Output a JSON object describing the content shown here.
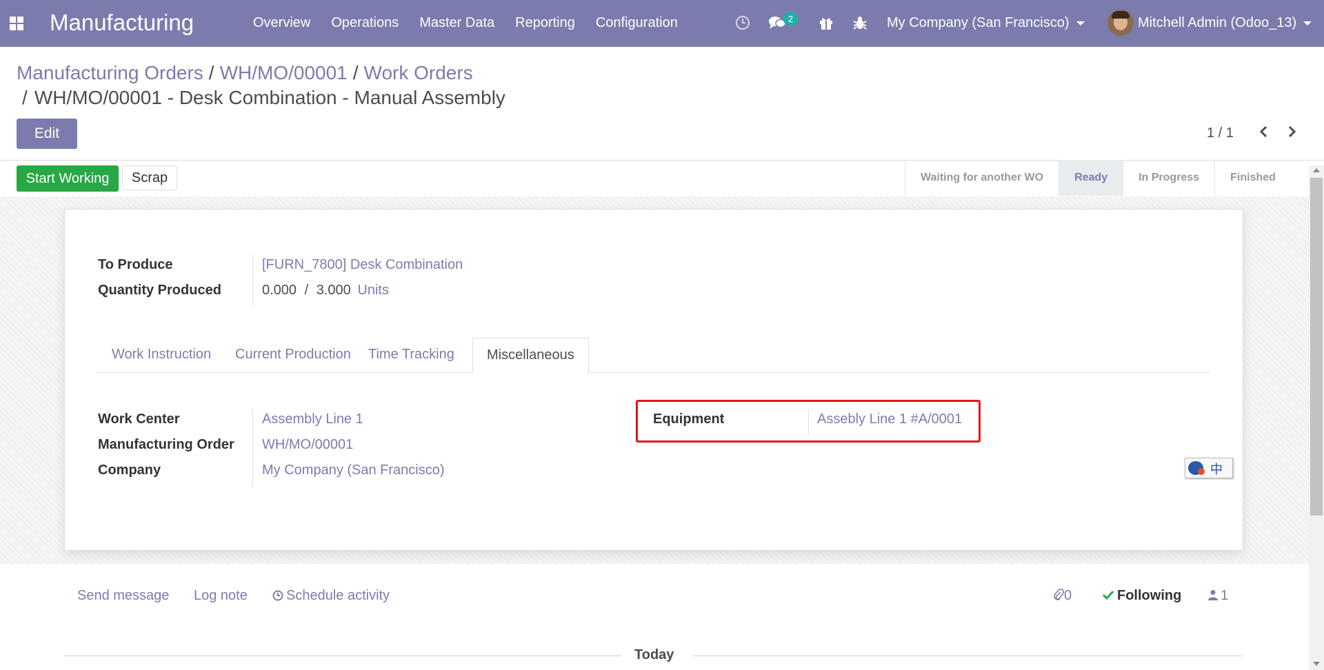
{
  "topbar": {
    "app_title": "Manufacturing",
    "menu": [
      "Overview",
      "Operations",
      "Master Data",
      "Reporting",
      "Configuration"
    ],
    "messages_badge": "2",
    "company": "My Company (San Francisco)",
    "user": "Mitchell Admin (Odoo_13)"
  },
  "breadcrumb": {
    "items": [
      "Manufacturing Orders",
      "WH/MO/00001",
      "Work Orders"
    ],
    "separator": "/",
    "current": "WH/MO/00001 - Desk Combination - Manual Assembly"
  },
  "controls": {
    "edit_label": "Edit",
    "pager": "1 / 1"
  },
  "statusbar": {
    "start_label": "Start Working",
    "scrap_label": "Scrap",
    "stages": [
      "Waiting for another WO",
      "Ready",
      "In Progress",
      "Finished"
    ],
    "active_stage": "Ready"
  },
  "form": {
    "to_produce_label": "To Produce",
    "to_produce_value": "[FURN_7800] Desk Combination",
    "qty_label": "Quantity Produced",
    "qty_done": "0.000",
    "qty_sep": "/",
    "qty_total": "3.000",
    "qty_uom": "Units",
    "tabs": [
      "Work Instruction",
      "Current Production",
      "Time Tracking",
      "Miscellaneous"
    ],
    "active_tab": "Miscellaneous",
    "work_center_label": "Work Center",
    "work_center_value": "Assembly Line 1",
    "mo_label": "Manufacturing Order",
    "mo_value": "WH/MO/00001",
    "company_label": "Company",
    "company_value": "My Company (San Francisco)",
    "equipment_label": "Equipment",
    "equipment_value": "Assebly Line 1 #A/0001"
  },
  "ime": {
    "text": "中"
  },
  "chatter": {
    "send_message": "Send message",
    "log_note": "Log note",
    "schedule_activity": "Schedule activity",
    "attachments": "0",
    "following": "Following",
    "followers": "1",
    "today": "Today"
  },
  "colors": {
    "brand": "#7c7bad",
    "success": "#28a745",
    "highlight": "#e8141b",
    "badge": "#1eb1a5"
  }
}
